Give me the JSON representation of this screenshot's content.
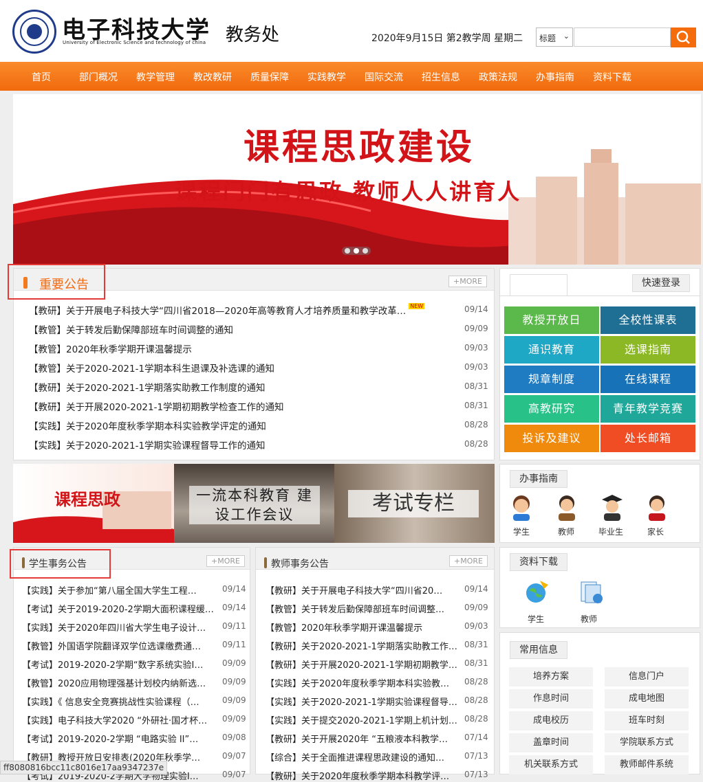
{
  "header": {
    "university_cn": "电子科技大学",
    "university_en": "University of Electronic Science and technology of china",
    "office": "教务处",
    "date": "2020年9月15日 第2教学周 星期二",
    "search_type": "标题",
    "search_placeholder": ""
  },
  "nav": [
    "首页",
    "部门概况",
    "教学管理",
    "教改教研",
    "质量保障",
    "实践教学",
    "国际交流",
    "招生信息",
    "政策法规",
    "办事指南",
    "资料下载"
  ],
  "banner": {
    "title": "课程思政建设",
    "subtitle": "课程门门有思政 教师人人讲育人"
  },
  "important": {
    "title": "重要公告",
    "more": "+MORE",
    "items": [
      {
        "text": "【教研】关于开展电子科技大学“四川省2018—2020年高等教育人才培养质量和教学改革…",
        "date": "09/14",
        "new": "NEW"
      },
      {
        "text": "【教管】关于转发后勤保障部班车时间调整的通知",
        "date": "09/09"
      },
      {
        "text": "【教管】2020年秋季学期开课温馨提示",
        "date": "09/03"
      },
      {
        "text": "【教管】关于2020-2021-1学期本科生退课及补选课的通知",
        "date": "09/03"
      },
      {
        "text": "【教研】关于2020-2021-1学期落实助教工作制度的通知",
        "date": "08/31"
      },
      {
        "text": "【教研】关于开展2020-2021-1学期初期教学检查工作的通知",
        "date": "08/31"
      },
      {
        "text": "【实践】关于2020年度秋季学期本科实验教学评定的通知",
        "date": "08/28"
      },
      {
        "text": "【实践】关于2020-2021-1学期实验课程督导工作的通知",
        "date": "08/28"
      }
    ]
  },
  "quick": {
    "tab": "快速登录",
    "tiles": [
      {
        "label": "教授开放日",
        "color": "#5bb84a"
      },
      {
        "label": "全校性课表",
        "color": "#1f6e94"
      },
      {
        "label": "通识教育",
        "color": "#1fa7c6"
      },
      {
        "label": "选课指南",
        "color": "#8cb825"
      },
      {
        "label": "规章制度",
        "color": "#1f7bc2"
      },
      {
        "label": "在线课程",
        "color": "#1772b8"
      },
      {
        "label": "高教研究",
        "color": "#28c289"
      },
      {
        "label": "青年教学竞赛",
        "color": "#1fa89a"
      },
      {
        "label": "投诉及建议",
        "color": "#f08a0c"
      },
      {
        "label": "处长邮箱",
        "color": "#f04d24"
      }
    ]
  },
  "promos": [
    "课程思政",
    "一流本科教育 建设工作会议",
    "考试专栏"
  ],
  "guide": {
    "title": "办事指南",
    "people": [
      "学生",
      "教师",
      "毕业生",
      "家长"
    ]
  },
  "student": {
    "title": "学生事务公告",
    "more": "+MORE",
    "items": [
      {
        "text": "【实践】关于参加“第八届全国大学生工程…",
        "date": "09/14"
      },
      {
        "text": "【考试】关于2019-2020-2学期大面积课程缓…",
        "date": "09/14"
      },
      {
        "text": "【实践】关于2020年四川省大学生电子设计…",
        "date": "09/11"
      },
      {
        "text": "【教管】外国语学院翻译双学位选课缴费通…",
        "date": "09/11"
      },
      {
        "text": "【考试】2019-2020-2学期“数字系统实验I…",
        "date": "09/09"
      },
      {
        "text": "【教管】2020应用物理强基计划校内纳新选…",
        "date": "09/09"
      },
      {
        "text": "【实践】《 信息安全竞赛挑战性实验课程（…",
        "date": "09/09"
      },
      {
        "text": "【实践】电子科技大学2020 “外研社·国才杯…",
        "date": "09/09"
      },
      {
        "text": "【考试】2019-2020-2学期 “电路实验 II”…",
        "date": "09/08"
      },
      {
        "text": "【教研】教授开放日安排表(2020年秋季学…",
        "date": "09/07"
      },
      {
        "text": "【考试】2019-2020-2学期大学物理实验I…",
        "date": "09/07"
      }
    ]
  },
  "teacher": {
    "title": "教师事务公告",
    "more": "+MORE",
    "items": [
      {
        "text": "【教研】关于开展电子科技大学“四川省20…",
        "date": "09/14"
      },
      {
        "text": "【教管】关于转发后勤保障部班车时间调整…",
        "date": "09/09"
      },
      {
        "text": "【教管】2020年秋季学期开课温馨提示",
        "date": "09/03"
      },
      {
        "text": "【教研】关于2020-2021-1学期落实助教工作…",
        "date": "08/31"
      },
      {
        "text": "【教研】关于开展2020-2021-1学期初期教学…",
        "date": "08/31"
      },
      {
        "text": "【实践】关于2020年度秋季学期本科实验教…",
        "date": "08/28"
      },
      {
        "text": "【实践】关于2020-2021-1学期实验课程督导…",
        "date": "08/28"
      },
      {
        "text": "【实践】关于提交2020-2021-1学期上机计划…",
        "date": "08/28"
      },
      {
        "text": "【教研】关于开展2020年 “五粮液本科教学…",
        "date": "07/14"
      },
      {
        "text": "【综合】关于全面推进课程思政建设的通知…",
        "date": "07/13"
      },
      {
        "text": "【教研】关于2020年度秋季学期本科教学评…",
        "date": "07/13"
      }
    ]
  },
  "download": {
    "title": "资料下载",
    "items": [
      "学生",
      "教师"
    ]
  },
  "info": {
    "title": "常用信息",
    "items": [
      "培养方案",
      "信息门户",
      "作息时间",
      "成电地图",
      "成电校历",
      "班车时刻",
      "盖章时间",
      "学院联系方式",
      "机关联系方式",
      "教师邮件系统"
    ]
  },
  "status_url": "ff8080816bcc11c8016e17aa9347237e"
}
